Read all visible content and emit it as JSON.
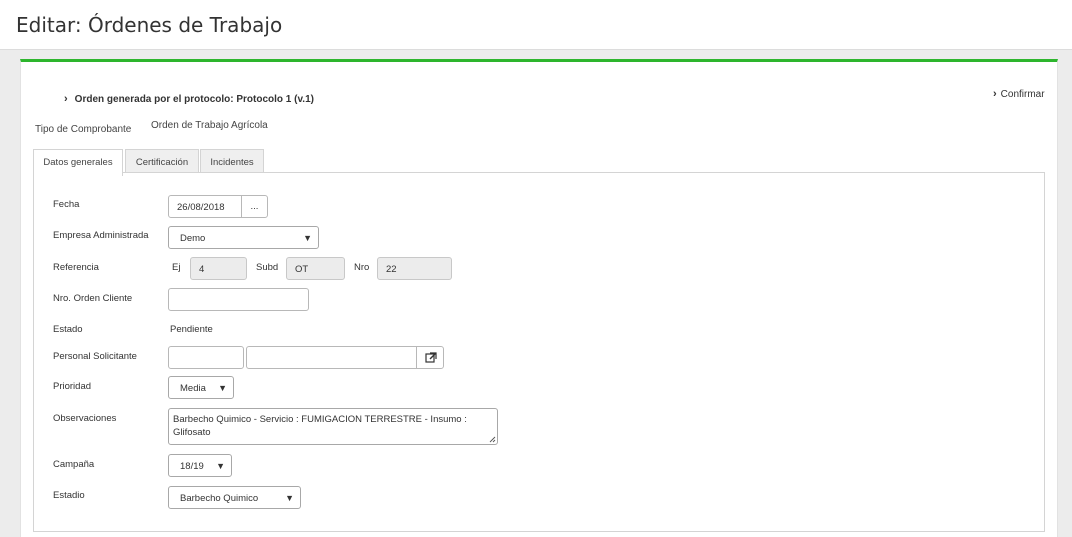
{
  "page": {
    "title": "Editar: Órdenes de Trabajo"
  },
  "panel": {
    "accent_color": "#2db52d",
    "protocol_text": "Orden generada por el protocolo: Protocolo 1 (v.1)",
    "confirm_label": "Confirmar",
    "chevron": "›",
    "tipo_comprobante_label": "Tipo de Comprobante",
    "tipo_comprobante_value": "Orden de Trabajo Agrícola"
  },
  "tabs": [
    {
      "label": "Datos generales",
      "active": true
    },
    {
      "label": "Certificación",
      "active": false
    },
    {
      "label": "Incidentes",
      "active": false
    }
  ],
  "form": {
    "fecha": {
      "label": "Fecha",
      "value": "26/08/2018",
      "button": "..."
    },
    "empresa": {
      "label": "Empresa Administrada",
      "value": "Demo"
    },
    "referencia": {
      "label": "Referencia",
      "ej_label": "Ej",
      "ej_value": "4",
      "subd_label": "Subd",
      "subd_value": "OT",
      "nro_label": "Nro",
      "nro_value": "22"
    },
    "nro_orden_cliente": {
      "label": "Nro. Orden Cliente",
      "value": ""
    },
    "estado": {
      "label": "Estado",
      "value": "Pendiente"
    },
    "personal_solicitante": {
      "label": "Personal Solicitante",
      "code": "",
      "name": ""
    },
    "prioridad": {
      "label": "Prioridad",
      "value": "Media"
    },
    "observaciones": {
      "label": "Observaciones",
      "value": "Barbecho Quimico - Servicio : FUMIGACION TERRESTRE - Insumo : Glifosato"
    },
    "campana": {
      "label": "Campaña",
      "value": "18/19"
    },
    "estadio": {
      "label": "Estadio",
      "value": "Barbecho Quimico"
    }
  }
}
